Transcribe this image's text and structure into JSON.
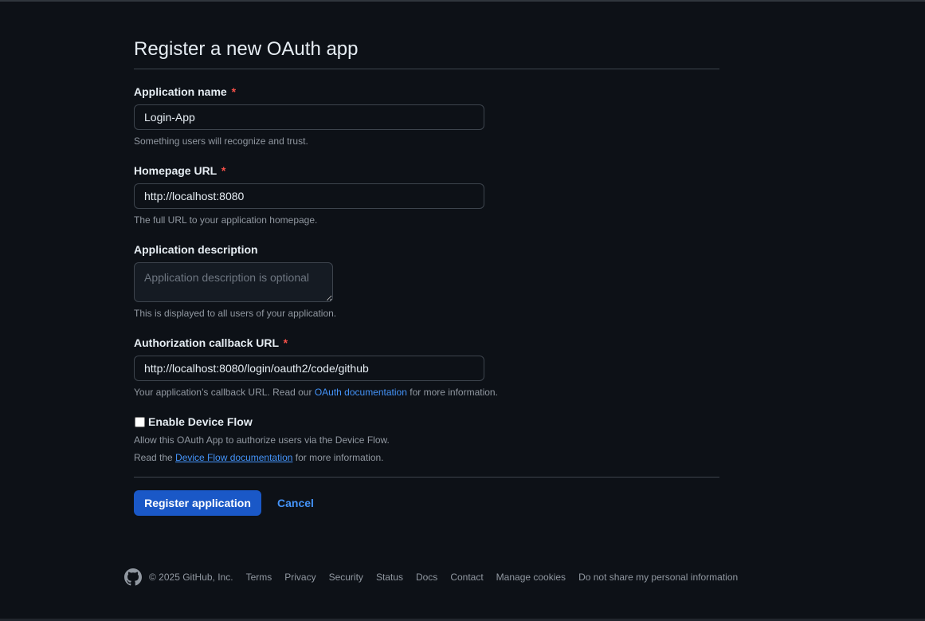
{
  "page": {
    "title": "Register a new OAuth app"
  },
  "form": {
    "app_name": {
      "label": "Application name",
      "required_mark": "*",
      "value": "Login-App",
      "hint": "Something users will recognize and trust."
    },
    "homepage_url": {
      "label": "Homepage URL",
      "required_mark": "*",
      "value": "http://localhost:8080",
      "hint": "The full URL to your application homepage."
    },
    "description": {
      "label": "Application description",
      "placeholder": "Application description is optional",
      "hint": "This is displayed to all users of your application."
    },
    "callback_url": {
      "label": "Authorization callback URL",
      "required_mark": "*",
      "value": "http://localhost:8080/login/oauth2/code/github",
      "hint_prefix": "Your application’s callback URL. Read our",
      "hint_link": "OAuth documentation",
      "hint_suffix": "for more information."
    },
    "device_flow": {
      "label": "Enable Device Flow",
      "checked": false,
      "hint1": "Allow this OAuth App to authorize users via the Device Flow.",
      "hint2_prefix": "Read the",
      "hint2_link": "Device Flow documentation",
      "hint2_suffix": "for more information."
    }
  },
  "actions": {
    "register_label": "Register application",
    "cancel_label": "Cancel"
  },
  "footer": {
    "logo_icon": "github-icon",
    "copyright": "© 2025 GitHub, Inc.",
    "links": [
      "Terms",
      "Privacy",
      "Security",
      "Status",
      "Docs",
      "Contact",
      "Manage cookies",
      "Do not share my personal information"
    ]
  },
  "colors": {
    "background": "#0d1117",
    "primary_button": "#1a58c7",
    "link": "#4493f8",
    "required": "#f85149"
  }
}
